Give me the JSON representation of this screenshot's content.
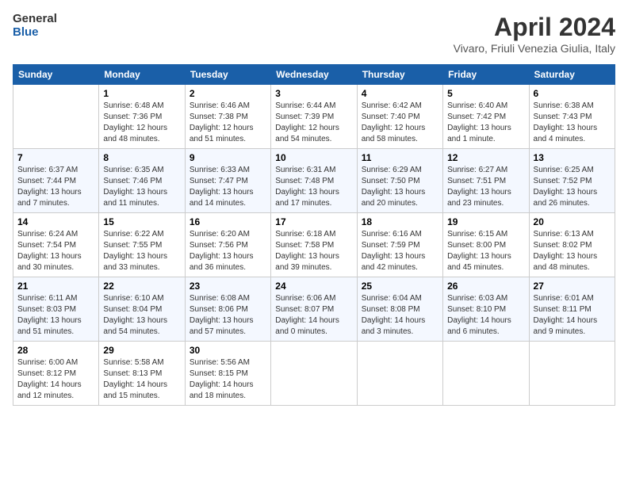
{
  "header": {
    "logo_line1": "General",
    "logo_line2": "Blue",
    "month": "April 2024",
    "location": "Vivaro, Friuli Venezia Giulia, Italy"
  },
  "weekdays": [
    "Sunday",
    "Monday",
    "Tuesday",
    "Wednesday",
    "Thursday",
    "Friday",
    "Saturday"
  ],
  "weeks": [
    [
      {
        "day": "",
        "text": ""
      },
      {
        "day": "1",
        "text": "Sunrise: 6:48 AM\nSunset: 7:36 PM\nDaylight: 12 hours\nand 48 minutes."
      },
      {
        "day": "2",
        "text": "Sunrise: 6:46 AM\nSunset: 7:38 PM\nDaylight: 12 hours\nand 51 minutes."
      },
      {
        "day": "3",
        "text": "Sunrise: 6:44 AM\nSunset: 7:39 PM\nDaylight: 12 hours\nand 54 minutes."
      },
      {
        "day": "4",
        "text": "Sunrise: 6:42 AM\nSunset: 7:40 PM\nDaylight: 12 hours\nand 58 minutes."
      },
      {
        "day": "5",
        "text": "Sunrise: 6:40 AM\nSunset: 7:42 PM\nDaylight: 13 hours\nand 1 minute."
      },
      {
        "day": "6",
        "text": "Sunrise: 6:38 AM\nSunset: 7:43 PM\nDaylight: 13 hours\nand 4 minutes."
      }
    ],
    [
      {
        "day": "7",
        "text": "Sunrise: 6:37 AM\nSunset: 7:44 PM\nDaylight: 13 hours\nand 7 minutes."
      },
      {
        "day": "8",
        "text": "Sunrise: 6:35 AM\nSunset: 7:46 PM\nDaylight: 13 hours\nand 11 minutes."
      },
      {
        "day": "9",
        "text": "Sunrise: 6:33 AM\nSunset: 7:47 PM\nDaylight: 13 hours\nand 14 minutes."
      },
      {
        "day": "10",
        "text": "Sunrise: 6:31 AM\nSunset: 7:48 PM\nDaylight: 13 hours\nand 17 minutes."
      },
      {
        "day": "11",
        "text": "Sunrise: 6:29 AM\nSunset: 7:50 PM\nDaylight: 13 hours\nand 20 minutes."
      },
      {
        "day": "12",
        "text": "Sunrise: 6:27 AM\nSunset: 7:51 PM\nDaylight: 13 hours\nand 23 minutes."
      },
      {
        "day": "13",
        "text": "Sunrise: 6:25 AM\nSunset: 7:52 PM\nDaylight: 13 hours\nand 26 minutes."
      }
    ],
    [
      {
        "day": "14",
        "text": "Sunrise: 6:24 AM\nSunset: 7:54 PM\nDaylight: 13 hours\nand 30 minutes."
      },
      {
        "day": "15",
        "text": "Sunrise: 6:22 AM\nSunset: 7:55 PM\nDaylight: 13 hours\nand 33 minutes."
      },
      {
        "day": "16",
        "text": "Sunrise: 6:20 AM\nSunset: 7:56 PM\nDaylight: 13 hours\nand 36 minutes."
      },
      {
        "day": "17",
        "text": "Sunrise: 6:18 AM\nSunset: 7:58 PM\nDaylight: 13 hours\nand 39 minutes."
      },
      {
        "day": "18",
        "text": "Sunrise: 6:16 AM\nSunset: 7:59 PM\nDaylight: 13 hours\nand 42 minutes."
      },
      {
        "day": "19",
        "text": "Sunrise: 6:15 AM\nSunset: 8:00 PM\nDaylight: 13 hours\nand 45 minutes."
      },
      {
        "day": "20",
        "text": "Sunrise: 6:13 AM\nSunset: 8:02 PM\nDaylight: 13 hours\nand 48 minutes."
      }
    ],
    [
      {
        "day": "21",
        "text": "Sunrise: 6:11 AM\nSunset: 8:03 PM\nDaylight: 13 hours\nand 51 minutes."
      },
      {
        "day": "22",
        "text": "Sunrise: 6:10 AM\nSunset: 8:04 PM\nDaylight: 13 hours\nand 54 minutes."
      },
      {
        "day": "23",
        "text": "Sunrise: 6:08 AM\nSunset: 8:06 PM\nDaylight: 13 hours\nand 57 minutes."
      },
      {
        "day": "24",
        "text": "Sunrise: 6:06 AM\nSunset: 8:07 PM\nDaylight: 14 hours\nand 0 minutes."
      },
      {
        "day": "25",
        "text": "Sunrise: 6:04 AM\nSunset: 8:08 PM\nDaylight: 14 hours\nand 3 minutes."
      },
      {
        "day": "26",
        "text": "Sunrise: 6:03 AM\nSunset: 8:10 PM\nDaylight: 14 hours\nand 6 minutes."
      },
      {
        "day": "27",
        "text": "Sunrise: 6:01 AM\nSunset: 8:11 PM\nDaylight: 14 hours\nand 9 minutes."
      }
    ],
    [
      {
        "day": "28",
        "text": "Sunrise: 6:00 AM\nSunset: 8:12 PM\nDaylight: 14 hours\nand 12 minutes."
      },
      {
        "day": "29",
        "text": "Sunrise: 5:58 AM\nSunset: 8:13 PM\nDaylight: 14 hours\nand 15 minutes."
      },
      {
        "day": "30",
        "text": "Sunrise: 5:56 AM\nSunset: 8:15 PM\nDaylight: 14 hours\nand 18 minutes."
      },
      {
        "day": "",
        "text": ""
      },
      {
        "day": "",
        "text": ""
      },
      {
        "day": "",
        "text": ""
      },
      {
        "day": "",
        "text": ""
      }
    ]
  ]
}
